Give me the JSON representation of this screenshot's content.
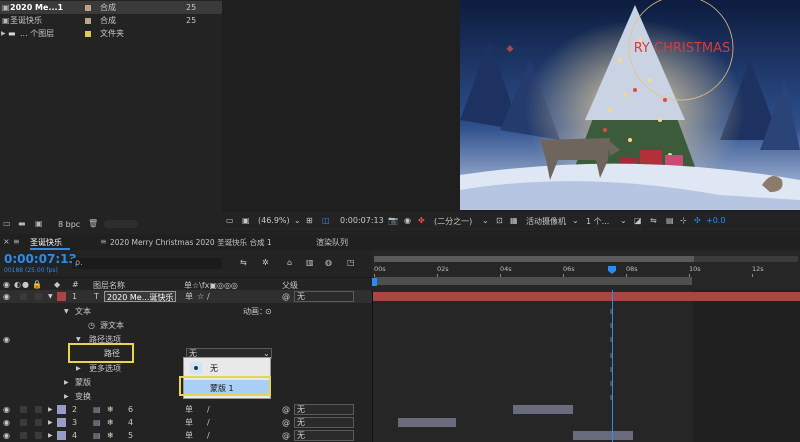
{
  "project": {
    "items": [
      {
        "name": "2020 Me...1",
        "type": "合成",
        "val": "25",
        "color": "#bfa28a",
        "selected": true
      },
      {
        "name": "圣诞快乐",
        "type": "合成",
        "val": "25",
        "color": "#bfa28a"
      },
      {
        "name": "... 个图层",
        "type": "文件夹",
        "val": "",
        "color": "#e3c65a"
      }
    ],
    "bpc": "8 bpc"
  },
  "viewer": {
    "zoom": "(46.9%)",
    "timecode": "0:00:07:13",
    "resolution": "(二分之一)",
    "camera": "活动摄像机",
    "view": "1 个...",
    "exposure": "+0.0"
  },
  "tabs": {
    "comp_tab": "圣诞快乐",
    "breadcrumb": "2020 Merry Christmas 2020 圣诞快乐 合成 1",
    "render_queue": "渲染队列"
  },
  "timeline": {
    "timecode": "0:00:07:13",
    "frame": "00188 (25.00 fps)",
    "search_placeholder": "ρ.",
    "col_layer_name": "图层名称",
    "col_parent": "父级",
    "col_num": "#",
    "col_switches": "单☆\\fx▣◎◎◎",
    "ruler": [
      "00s",
      "02s",
      "04s",
      "06s",
      "08s",
      "10s",
      "12s"
    ],
    "layers": {
      "l1": {
        "num": "1",
        "type": "T",
        "name": "2020 Me...诞快乐",
        "parent": "无"
      },
      "text": "文本",
      "anim_label": "动画：",
      "source_text": "源文本",
      "path_options": "路径选项",
      "path_label": "路径",
      "path_value": "无",
      "more_options": "更多选项",
      "masks": "蒙版",
      "transform": "变换",
      "l6": {
        "num": "2",
        "name": "6",
        "parent": "无"
      },
      "l4": {
        "num": "3",
        "name": "4",
        "parent": "无"
      },
      "l5": {
        "num": "4",
        "name": "5",
        "parent": "无"
      }
    },
    "dropdown": {
      "item_none": "无",
      "item_mask": "蒙版 1"
    },
    "switch_mark": "单"
  },
  "colors": {
    "accent": "#2d8ceb",
    "layer_red": "#a84646",
    "highlight": "#e8d44d",
    "bar_gray": "#6b6b7e"
  }
}
